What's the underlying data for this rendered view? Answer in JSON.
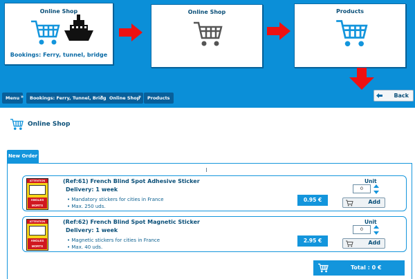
{
  "flow": {
    "step1": {
      "title": "Online Shop",
      "subtitle": "Bookings: Ferry, tunnel, bridge"
    },
    "step2": {
      "title": "Online Shop"
    },
    "step3": {
      "title": "Products"
    }
  },
  "breadcrumb": [
    {
      "label": "Menu"
    },
    {
      "label": "Bookings: Ferry, Tunnel, Bridge"
    },
    {
      "label": "Online Shop"
    },
    {
      "label": "Products"
    }
  ],
  "back_label": "Back",
  "page_title": "Online Shop",
  "tab_label": "New Order",
  "products": [
    {
      "title": "(Ref:61) French Blind Spot Adhesive Sticker",
      "delivery": "Delivery: 1 week",
      "bullets": [
        "Mandatory stickers for cities in France",
        "Max. 250 uds."
      ],
      "price": "0.95 €",
      "unit_label": "Unit",
      "quantity": "0",
      "add_label": "Add",
      "image_text": {
        "attention": "ATTENTION",
        "line1": "ANGLES",
        "line2": "MORTS"
      }
    },
    {
      "title": "(Ref:62) French Blind Spot Magnetic Sticker",
      "delivery": "Delivery: 1 week",
      "bullets": [
        "Magnetic stickers for cities in France",
        "Max. 40 uds."
      ],
      "price": "2.95 €",
      "unit_label": "Unit",
      "quantity": "0",
      "add_label": "Add",
      "image_text": {
        "attention": "ATTENTION",
        "line1": "ANGLES",
        "line2": "MORTS"
      }
    }
  ],
  "total_label": "Total : 0 €",
  "colors": {
    "brand_blue": "#0b8fd8",
    "button_blue": "#1395dc",
    "arrow_red": "#ee1111",
    "text_dark": "#0a4f78"
  }
}
